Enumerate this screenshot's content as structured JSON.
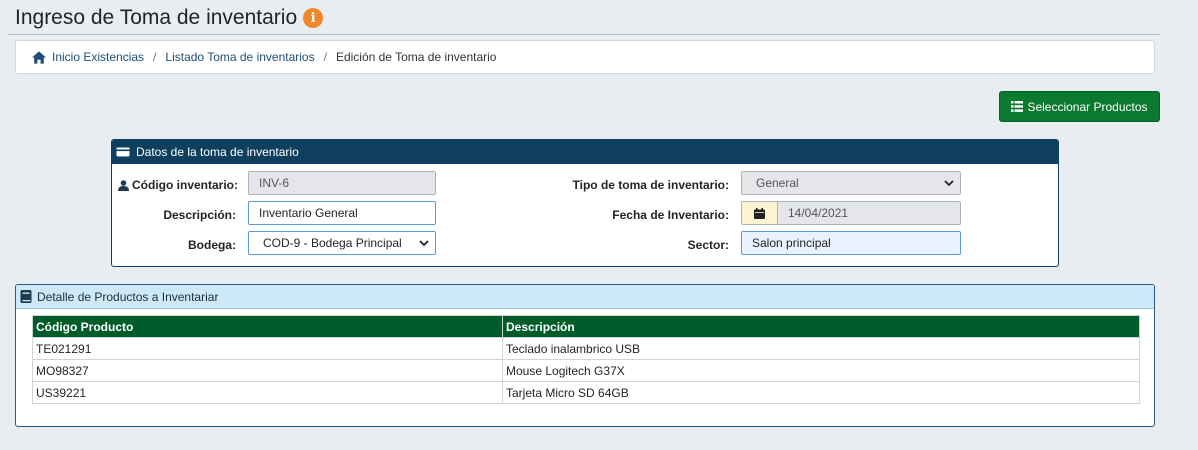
{
  "page": {
    "title": "Ingreso de Toma de inventario"
  },
  "breadcrumb": {
    "items": [
      "Inicio Existencias",
      "Listado Toma de inventarios"
    ],
    "current": "Edición de Toma de inventario"
  },
  "toolbar": {
    "select_products_label": "Seleccionar Productos"
  },
  "data_panel": {
    "title": "Datos de la toma de inventario",
    "codigo": {
      "label": "Código inventario:",
      "value": "INV-6"
    },
    "descripcion": {
      "label": "Descripción:",
      "value": "Inventario General"
    },
    "bodega": {
      "label": "Bodega:",
      "value": "COD-9 - Bodega Principal"
    },
    "tipo": {
      "label": "Tipo de toma de inventario:",
      "value": "General"
    },
    "fecha": {
      "label": "Fecha de Inventario:",
      "value": "14/04/2021"
    },
    "sector": {
      "label": "Sector:",
      "value": "Salon principal"
    }
  },
  "detail_panel": {
    "title": "Detalle de Productos a Inventariar",
    "columns": [
      "Código Producto",
      "Descripción"
    ],
    "rows": [
      [
        "TE021291",
        "Teclado inalambrico USB"
      ],
      [
        "MO98327",
        "Mouse Logitech G37X"
      ],
      [
        "US39221",
        "Tarjeta Micro SD 64GB"
      ]
    ]
  },
  "colors": {
    "primary_dark": "#0e3f5e",
    "success": "#0b7a2f",
    "table_header": "#005c2b",
    "info_badge": "#f0882a",
    "panel_light": "#cde8f7"
  }
}
